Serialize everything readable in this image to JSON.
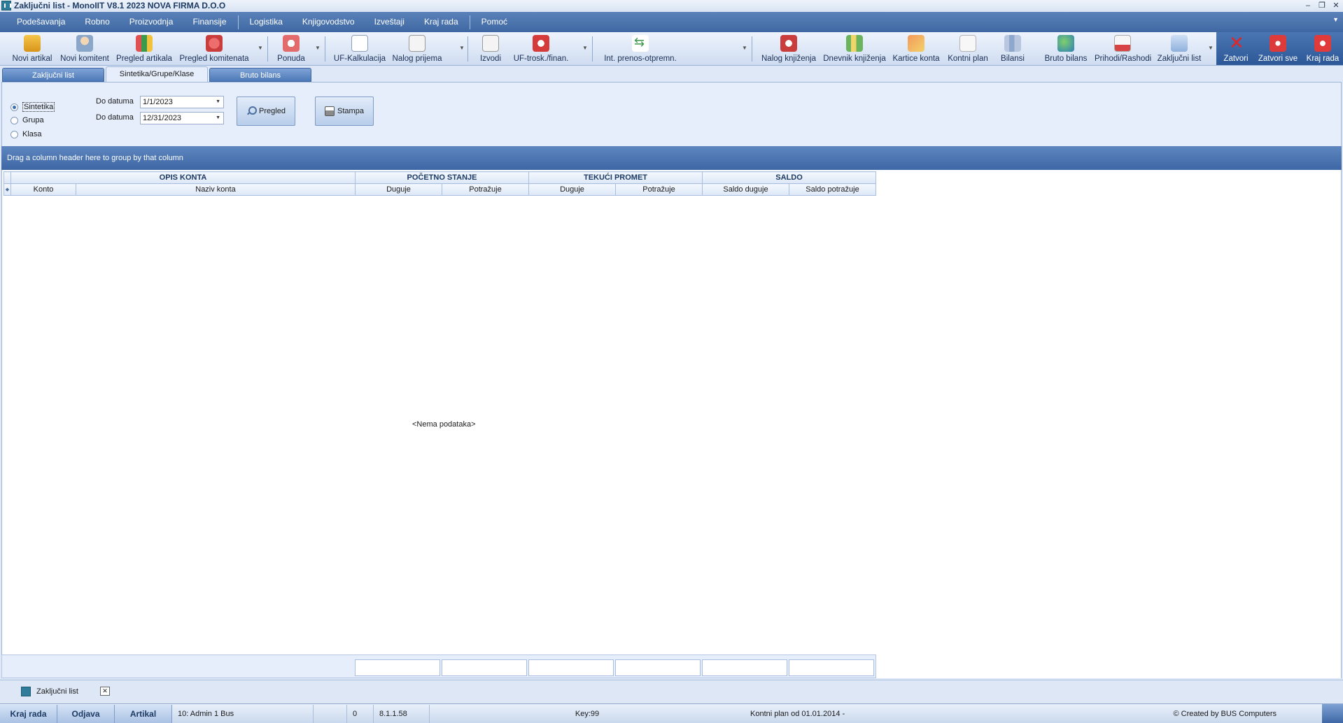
{
  "window": {
    "title": "Zaključni list - MonoIIT V8.1 2023 NOVA FIRMA D.O.O",
    "controls": [
      "–",
      "❐",
      "✕"
    ]
  },
  "menu": {
    "items": [
      "Podešavanja",
      "Robno",
      "Proizvodnja",
      "Finansije",
      "Logistika",
      "Knjigovodstvo",
      "Izveštaji",
      "Kraj rada",
      "Pomoć"
    ]
  },
  "toolbar": {
    "novi_artikal": "Novi artikal",
    "novi_komitent": "Novi komitent",
    "pregled_artikala": "Pregled artikala",
    "pregled_komitenata": "Pregled komitenata",
    "ponuda": "Ponuda",
    "uf_kalkulacija": "UF-Kalkulacija",
    "nalog_prijema": "Nalog prijema",
    "izvodi": "Izvodi",
    "uf_trosk": "UF-trosk./finan.",
    "int_prenos": "Int. prenos-otpremn.",
    "nalog_knjizenja": "Nalog knjiženja",
    "dnevnik_knjizenja": "Dnevnik knjiženja",
    "kartice_konta": "Kartice konta",
    "kontni_plan": "Kontni plan",
    "bilansi": "Bilansi",
    "bruto_bilans": "Bruto bilans",
    "prihodi_rashodi": "Prihodi/Rashodi",
    "zakljucni_list": "Zaključni list",
    "zatvori": "Zatvori",
    "zatvori_sve": "Zatvori sve",
    "kraj_rada": "Kraj rada"
  },
  "tabs": {
    "t1": "Zaključni list",
    "t2": "Sintetika/Grupe/Klase",
    "t3": "Bruto bilans"
  },
  "filter": {
    "radio_sintetika": "Sintetika",
    "radio_grupa": "Grupa",
    "radio_klasa": "Klasa",
    "selected": "Sintetika",
    "date_from_label": "Do datuma",
    "date_from_value": "1/1/2023",
    "date_to_label": "Do datuma",
    "date_to_value": "12/31/2023",
    "pregled_button": "Pregled",
    "stampa_button": "Stampa"
  },
  "grid": {
    "group_hint": "Drag a column header here to group by that column",
    "bands": {
      "opis": "OPIS KONTA",
      "pocetno": "POČETNO STANJE",
      "tekuci": "TEKUĆI PROMET",
      "saldo": "SALDO"
    },
    "columns": {
      "konto": "Konto",
      "naziv": "Naziv konta",
      "ps_duguje": "Duguje",
      "ps_potrazuje": "Potražuje",
      "tp_duguje": "Duguje",
      "tp_potrazuje": "Potražuje",
      "saldo_duguje": "Saldo duguje",
      "saldo_potrazuje": "Saldo potražuje"
    },
    "empty_text": "<Nema podataka>"
  },
  "mdi": {
    "tab_label": "Zaključni list",
    "close": "✕"
  },
  "status": {
    "kraj_rada": "Kraj rada",
    "odjava": "Odjava",
    "artikal": "Artikal",
    "user": "10: Admin 1 Bus",
    "zero": "0",
    "ip": "8.1.1.58",
    "key": "Key:99",
    "kontni_plan": "Kontni plan od 01.01.2014 -",
    "created_by": "© Created by BUS Computers"
  }
}
